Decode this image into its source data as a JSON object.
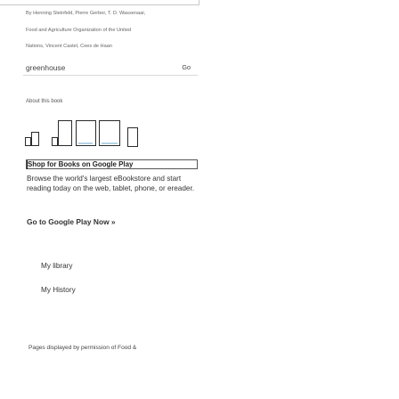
{
  "book": {
    "authors_line": "By Henning Steinfeld, Pierre Gerber, T. D. Wassenaar,",
    "publisher_line": "Food and Agriculture Organization of the United",
    "more_authors_line": "Nations, Vincent Castel, Cees de Haan"
  },
  "search": {
    "value": "greenhouse",
    "go_label": "Go"
  },
  "about_label": "About this book",
  "logo": {
    "icon_name": "google-books-logo-glyphs"
  },
  "shop": {
    "label": "Shop for Books on Google Play"
  },
  "browse_text": "Browse the world's largest eBookstore and start reading today on the web, tablet, phone, or ereader.",
  "go_play_label": "Go to Google Play Now »",
  "nav": {
    "library_label": "My library",
    "history_label": "My History"
  },
  "footer_note": "Pages displayed by permission of Food &"
}
